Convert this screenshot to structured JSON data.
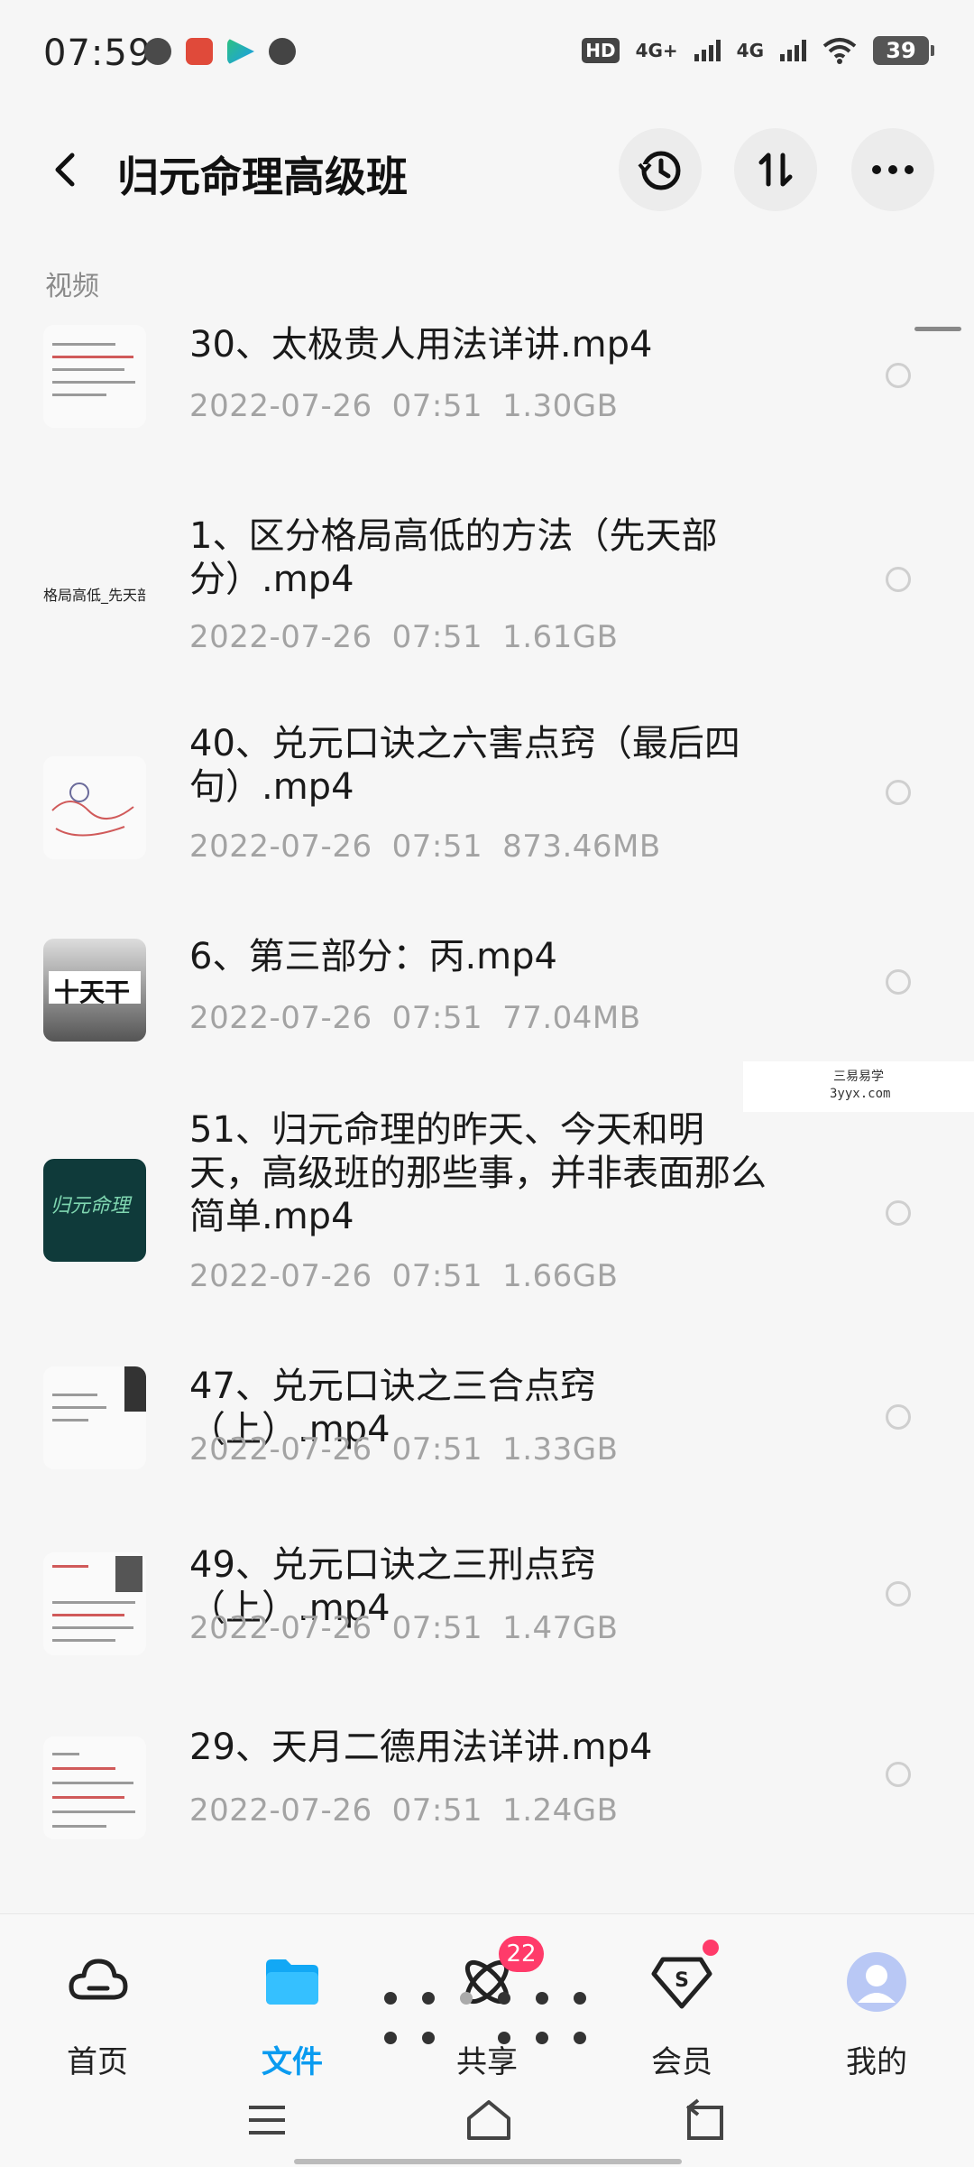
{
  "status_bar": {
    "time": "07:59",
    "network_hd": "HD",
    "net1": "4G+",
    "net2": "4G",
    "battery": "39"
  },
  "header": {
    "title": "归元命理高级班"
  },
  "section": {
    "label": "视频"
  },
  "files": [
    {
      "name": "30、太极贵人用法详讲.mp4",
      "date": "2022-07-26",
      "time": "07:51",
      "size": "1.30GB"
    },
    {
      "name": "1、区分格局高低的方法（先天部分）.mp4",
      "date": "2022-07-26",
      "time": "07:51",
      "size": "1.61GB",
      "thumb_text": "格局高低_先天部"
    },
    {
      "name": "40、兑元口诀之六害点窍（最后四句）.mp4",
      "date": "2022-07-26",
      "time": "07:51",
      "size": "873.46MB"
    },
    {
      "name": "6、第三部分：丙.mp4",
      "date": "2022-07-26",
      "time": "07:51",
      "size": "77.04MB",
      "thumb_text": "十天干"
    },
    {
      "name": "51、归元命理的昨天、今天和明天，高级班的那些事，并非表面那么简单.mp4",
      "date": "2022-07-26",
      "time": "07:51",
      "size": "1.66GB",
      "thumb_text": "归元命理"
    },
    {
      "name": "47、兑元口诀之三合点窍（上）.mp4",
      "date": "2022-07-26",
      "time": "07:51",
      "size": "1.33GB"
    },
    {
      "name": "49、兑元口诀之三刑点窍（上）.mp4",
      "date": "2022-07-26",
      "time": "07:51",
      "size": "1.47GB"
    },
    {
      "name": "29、天月二德用法详讲.mp4",
      "date": "2022-07-26",
      "time": "07:51",
      "size": "1.24GB"
    }
  ],
  "watermark": {
    "line1": "三易易学",
    "line2": "3yyx.com"
  },
  "bottom_nav": {
    "tabs": [
      {
        "label": "首页",
        "icon": "cloud-icon"
      },
      {
        "label": "文件",
        "icon": "folder-icon",
        "active": true
      },
      {
        "label": "共享",
        "icon": "atom-icon",
        "badge": "22"
      },
      {
        "label": "会员",
        "icon": "vip-diamond-icon",
        "dot": true
      },
      {
        "label": "我的",
        "icon": "avatar-icon"
      }
    ]
  },
  "colors": {
    "accent": "#0a9bf0",
    "badge": "#ff3b6a",
    "meta": "#a3a3a3"
  }
}
